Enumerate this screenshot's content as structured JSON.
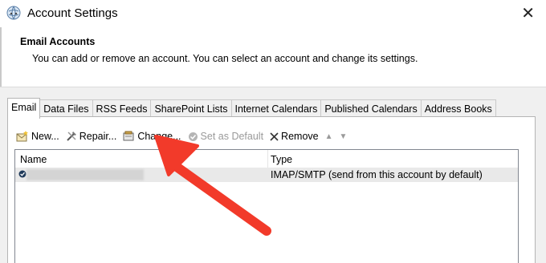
{
  "window": {
    "title": "Account Settings",
    "close_icon": "close-icon",
    "app_icon": "outlook-globe-icon"
  },
  "header": {
    "title": "Email Accounts",
    "subtitle": "You can add or remove an account. You can select an account and change its settings."
  },
  "tabs": [
    {
      "label": "Email",
      "active": true
    },
    {
      "label": "Data Files",
      "active": false
    },
    {
      "label": "RSS Feeds",
      "active": false
    },
    {
      "label": "SharePoint Lists",
      "active": false
    },
    {
      "label": "Internet Calendars",
      "active": false
    },
    {
      "label": "Published Calendars",
      "active": false
    },
    {
      "label": "Address Books",
      "active": false
    }
  ],
  "toolbar": {
    "new_label": "New...",
    "repair_label": "Repair...",
    "change_label": "Change...",
    "set_default_label": "Set as Default",
    "remove_label": "Remove",
    "move_up_icon": "arrow-up-icon",
    "move_down_icon": "arrow-down-icon"
  },
  "accounts_list": {
    "columns": [
      "Name",
      "Type"
    ],
    "rows": [
      {
        "name": "",
        "type": "IMAP/SMTP (send from this account by default)",
        "is_default": true
      }
    ]
  },
  "colors": {
    "annotation_arrow": "#f23a2a",
    "dialog_body": "#f0f0f0",
    "selected_row": "#e9e9e9"
  }
}
